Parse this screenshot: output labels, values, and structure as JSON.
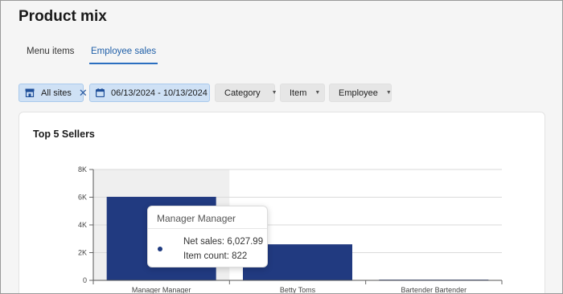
{
  "page": {
    "title": "Product mix"
  },
  "tabs": [
    {
      "label": "Menu items",
      "active": false
    },
    {
      "label": "Employee sales",
      "active": true
    }
  ],
  "filters": {
    "sites": {
      "label": "All sites",
      "icon": "store-icon"
    },
    "dates": {
      "label": "06/13/2024 - 10/13/2024",
      "icon": "calendar-icon"
    },
    "category": {
      "label": "Category"
    },
    "item": {
      "label": "Item"
    },
    "employee": {
      "label": "Employee"
    }
  },
  "card": {
    "title": "Top 5 Sellers"
  },
  "colors": {
    "bar": "#213a80",
    "accent": "#2b6fc0",
    "chip_bg": "#cfe1f5"
  },
  "chart_data": {
    "type": "bar",
    "title": "Top 5 Sellers",
    "categories": [
      "Manager Manager",
      "Betty Toms",
      "Bartender Bartender"
    ],
    "values": [
      6027.99,
      2600,
      50
    ],
    "ylim": [
      0,
      8000
    ],
    "yticks": [
      "0",
      "2K",
      "4K",
      "6K",
      "8K"
    ],
    "grid": true,
    "hover_category": "Manager Manager"
  },
  "tooltip": {
    "title": "Manager Manager",
    "net_sales": "Net sales: 6,027.99",
    "item_count": "Item count: 822"
  }
}
